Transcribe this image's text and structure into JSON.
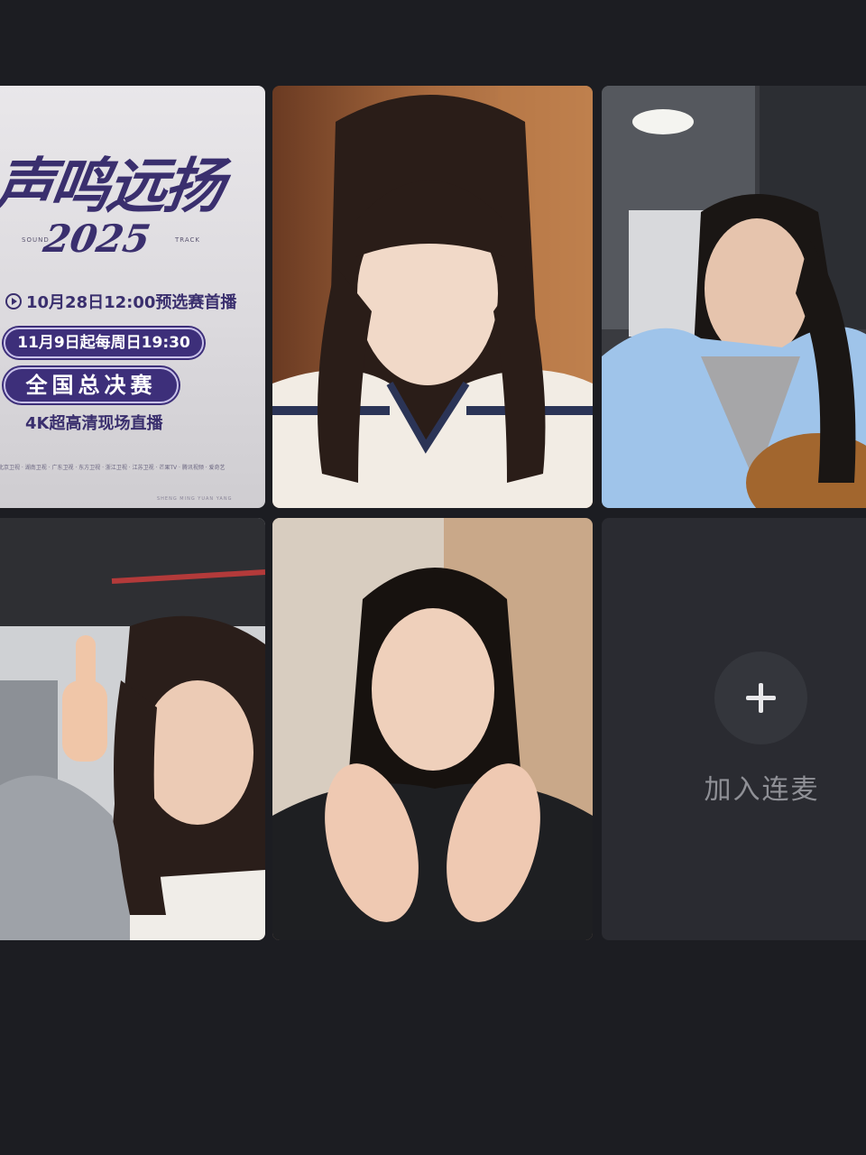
{
  "poster": {
    "title": "声鸣远扬",
    "sound": "SOUND",
    "track": "TRACK",
    "year": "2025",
    "premiere": "10月28日12:00预选赛首播",
    "schedule": "11月9日起每周日19:30",
    "finals": "全国总决赛",
    "broadcast": "4K超高清现场直播",
    "sponsors": "北京卫视 · 湖南卫视 · 广东卫视 · 东方卫视 · 浙江卫视 · 江苏卫视 · 芒果TV · 腾讯视频 · 爱奇艺",
    "footer": "SHENG MING YUAN YANG"
  },
  "join": {
    "icon": "plus-icon",
    "label": "加入连麦"
  },
  "colors": {
    "background": "#1c1d22",
    "join_tile": "#2a2b31",
    "poster_accent": "#3a2f6e"
  }
}
